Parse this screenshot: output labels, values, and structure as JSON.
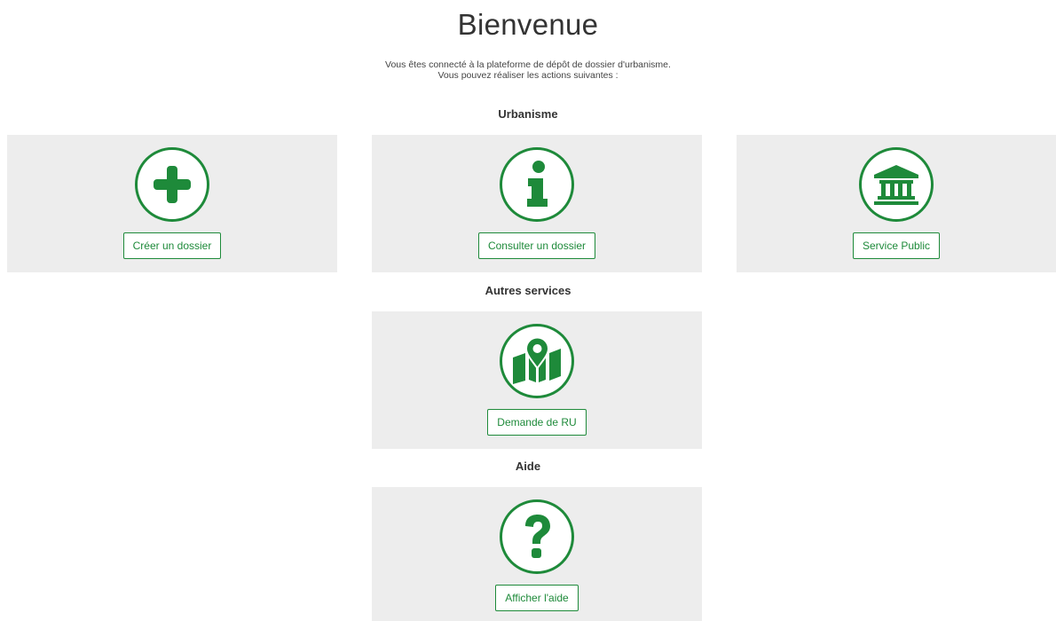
{
  "header": {
    "title": "Bienvenue",
    "intro_line1": "Vous êtes connecté à la plateforme de dépôt de dossier d'urbanisme.",
    "intro_line2": "Vous pouvez réaliser les actions suivantes :"
  },
  "sections": {
    "urbanisme": {
      "title": "Urbanisme",
      "cards": [
        {
          "label": "Créer un dossier",
          "icon": "plus-icon"
        },
        {
          "label": "Consulter un dossier",
          "icon": "info-icon"
        },
        {
          "label": "Service Public",
          "icon": "public-building-icon"
        }
      ]
    },
    "autres": {
      "title": "Autres services",
      "cards": [
        {
          "label": "Demande de RU",
          "icon": "map-pin-icon"
        }
      ]
    },
    "aide": {
      "title": "Aide",
      "cards": [
        {
          "label": "Afficher l'aide",
          "icon": "question-icon"
        }
      ]
    }
  },
  "colors": {
    "accent": "#1e8a3a",
    "card_background": "#ededed",
    "page_background": "#ffffff"
  }
}
